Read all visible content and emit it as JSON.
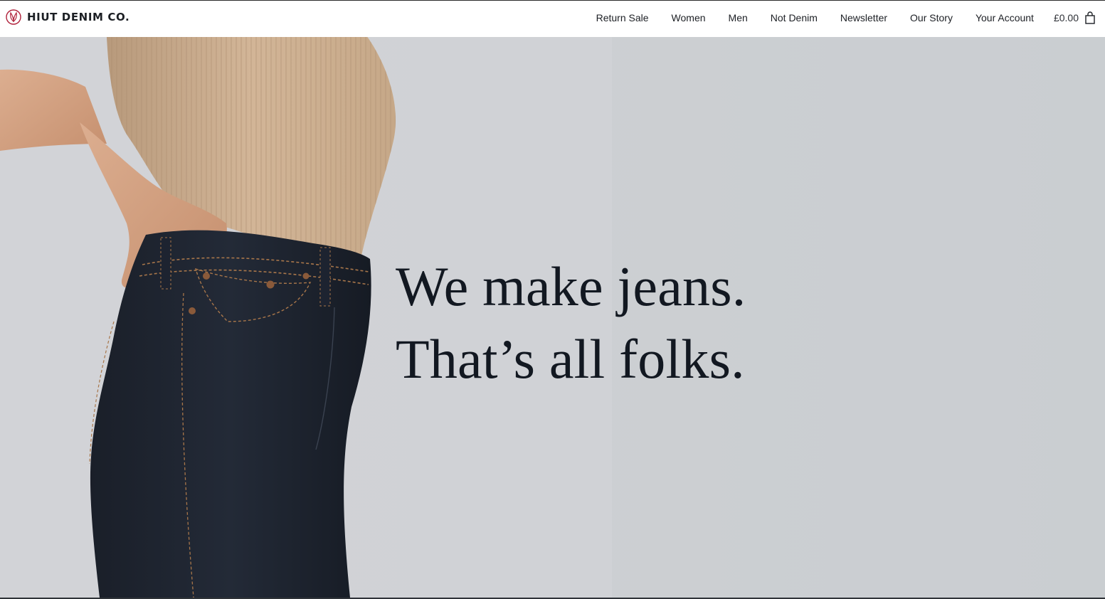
{
  "brand": {
    "name": "HIUT DENIM CO.",
    "logo_icon": "hiut-leaf-logo-icon",
    "accent": "#b0213b"
  },
  "nav": {
    "items": [
      {
        "label": "Return Sale"
      },
      {
        "label": "Women"
      },
      {
        "label": "Men"
      },
      {
        "label": "Not Denim"
      },
      {
        "label": "Newsletter"
      },
      {
        "label": "Our Story"
      },
      {
        "label": "Your Account"
      }
    ],
    "cart_total": "£0.00",
    "cart_icon": "shopping-bag-icon"
  },
  "hero": {
    "line1": "We make jeans.",
    "line2": "That’s all folks.",
    "text_color": "#121821",
    "background": "#cfd2d6"
  }
}
